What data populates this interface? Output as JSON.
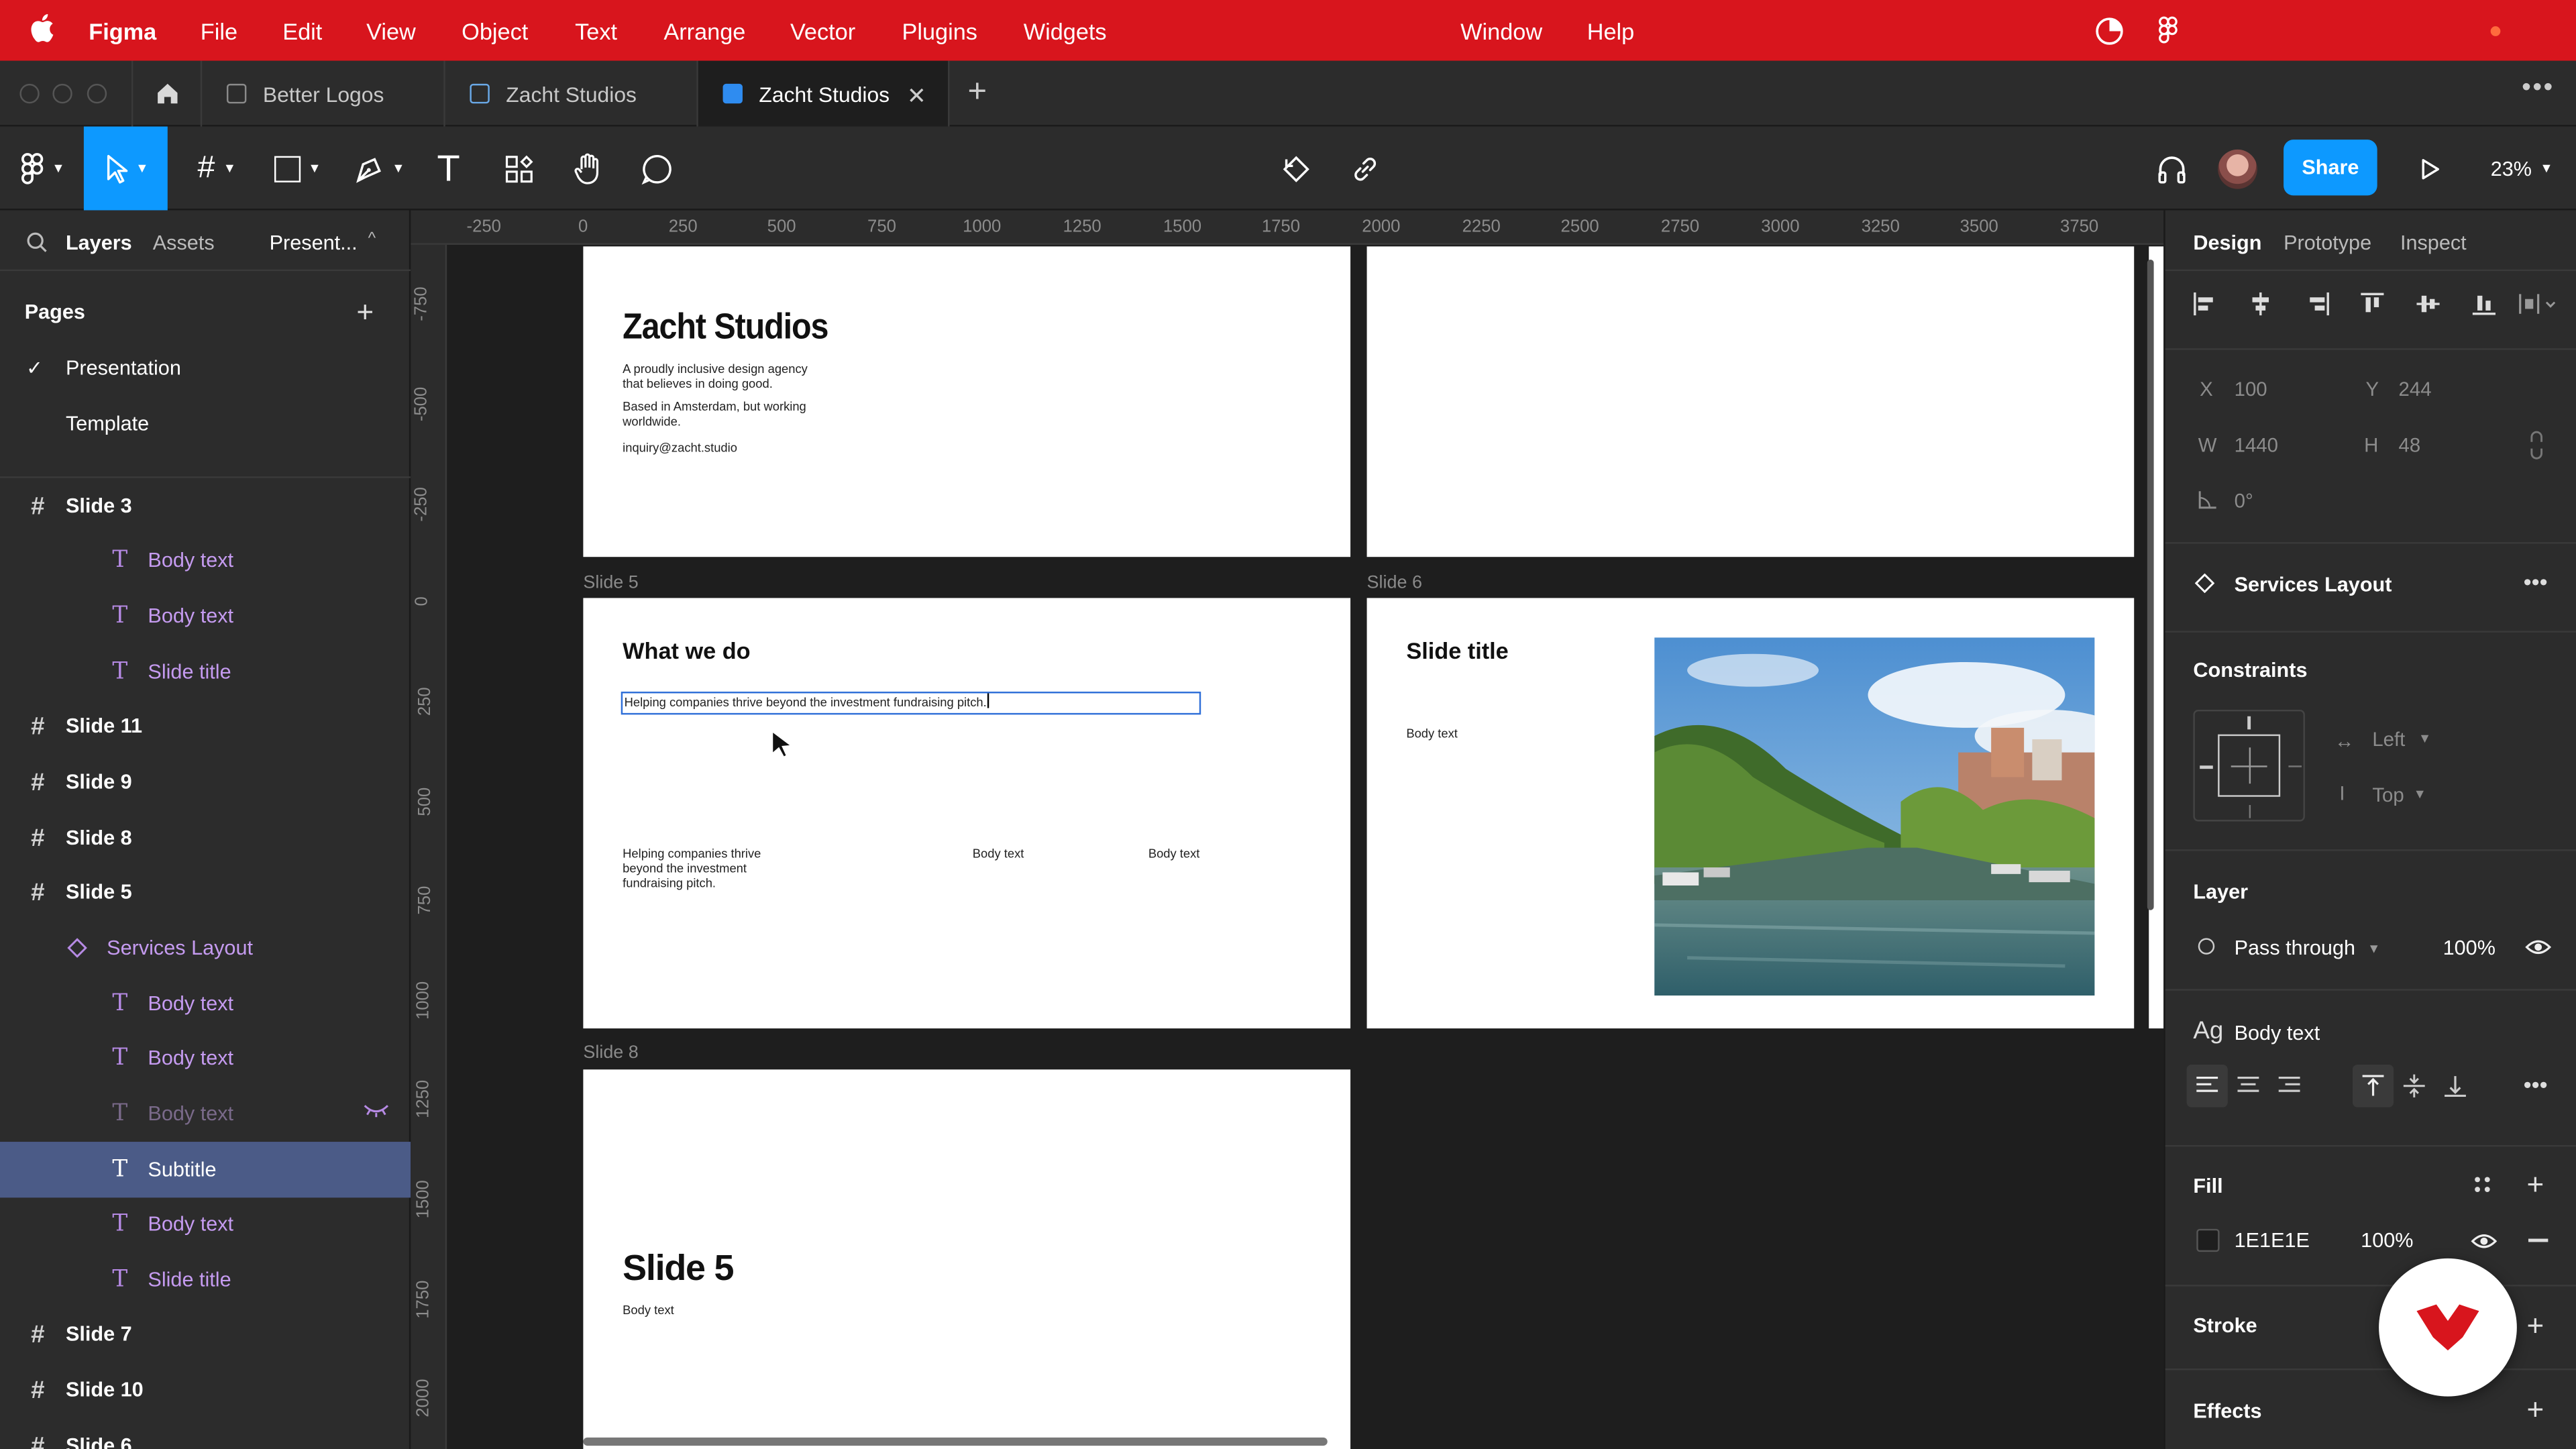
{
  "menubar": {
    "app": "Figma",
    "items": [
      "File",
      "Edit",
      "View",
      "Object",
      "Text",
      "Arrange",
      "Vector",
      "Plugins",
      "Widgets"
    ],
    "right_items": [
      "Window",
      "Help"
    ]
  },
  "tabs": [
    {
      "label": "Better Logos",
      "active": false
    },
    {
      "label": "Zacht Studios",
      "active": false
    },
    {
      "label": "Zacht Studios",
      "active": true
    }
  ],
  "toolbar": {
    "share_label": "Share",
    "zoom": "23%"
  },
  "left_panel": {
    "tabs": {
      "layers": "Layers",
      "assets": "Assets",
      "page": "Present..."
    },
    "pages_heading": "Pages",
    "pages": [
      {
        "label": "Presentation",
        "checked": true
      },
      {
        "label": "Template",
        "checked": false
      }
    ],
    "layers": [
      {
        "label": "Slide 3",
        "kind": "frame"
      },
      {
        "label": "Body text",
        "kind": "text"
      },
      {
        "label": "Body text",
        "kind": "text"
      },
      {
        "label": "Slide title",
        "kind": "text"
      },
      {
        "label": "Slide 11",
        "kind": "frame"
      },
      {
        "label": "Slide 9",
        "kind": "frame"
      },
      {
        "label": "Slide 8",
        "kind": "frame"
      },
      {
        "label": "Slide 5",
        "kind": "frame"
      },
      {
        "label": "Services Layout",
        "kind": "component"
      },
      {
        "label": "Body text",
        "kind": "text"
      },
      {
        "label": "Body text",
        "kind": "text"
      },
      {
        "label": "Body text",
        "kind": "text-hidden"
      },
      {
        "label": "Subtitle",
        "kind": "text-selected"
      },
      {
        "label": "Body text",
        "kind": "text"
      },
      {
        "label": "Slide title",
        "kind": "text"
      },
      {
        "label": "Slide 7",
        "kind": "frame"
      },
      {
        "label": "Slide 10",
        "kind": "frame"
      },
      {
        "label": "Slide 6",
        "kind": "frame"
      }
    ]
  },
  "canvas": {
    "ruler_h": [
      "-250",
      "0",
      "250",
      "500",
      "750",
      "1000",
      "1250",
      "1500",
      "1750",
      "2000",
      "2250",
      "2500",
      "2750",
      "3000",
      "3250",
      "3500",
      "3750"
    ],
    "ruler_v": [
      "-750",
      "-500",
      "-250",
      "0",
      "250",
      "500",
      "750",
      "1000",
      "1250",
      "1500",
      "1750",
      "2000"
    ],
    "slide_top_left": {
      "title": "Zacht Studios",
      "line1": "A proudly inclusive design agency",
      "line2": "that believes in doing good.",
      "line3": "Based in Amsterdam, but working",
      "line4": "worldwide.",
      "email": "inquiry@zacht.studio"
    },
    "slide5": {
      "label": "Slide 5",
      "title": "What we do",
      "subtitle": "Helping companies thrive beyond the investment fundraising pitch.",
      "col1_l1": "Helping companies thrive",
      "col1_l2": "beyond the investment",
      "col1_l3": "fundraising pitch.",
      "col2": "Body text",
      "col3": "Body text"
    },
    "slide6": {
      "label": "Slide 6",
      "title": "Slide title",
      "body": "Body text"
    },
    "slide8": {
      "label": "Slide 8",
      "title": "Slide 5",
      "body": "Body text"
    }
  },
  "right_panel": {
    "tabs": {
      "design": "Design",
      "prototype": "Prototype",
      "inspect": "Inspect"
    },
    "x_label": "X",
    "x": "100",
    "y_label": "Y",
    "y": "244",
    "w_label": "W",
    "w": "1440",
    "h_label": "H",
    "h": "48",
    "rotation": "0°",
    "component": "Services Layout",
    "constraints_heading": "Constraints",
    "constraint_h": "Left",
    "constraint_v": "Top",
    "layer_heading": "Layer",
    "blend": "Pass through",
    "layer_opacity": "100%",
    "text_style_prefix": "Ag",
    "text_style": "Body text",
    "fill_heading": "Fill",
    "fill_hex": "1E1E1E",
    "fill_opacity": "100%",
    "fill_color": "#1e1e1e",
    "stroke_heading": "Stroke",
    "effects_heading": "Effects"
  },
  "colors": {
    "menubar": "#d8151d",
    "accent": "#0d99ff",
    "selection": "#4b5b87",
    "text_layer": "#c59bf0"
  }
}
